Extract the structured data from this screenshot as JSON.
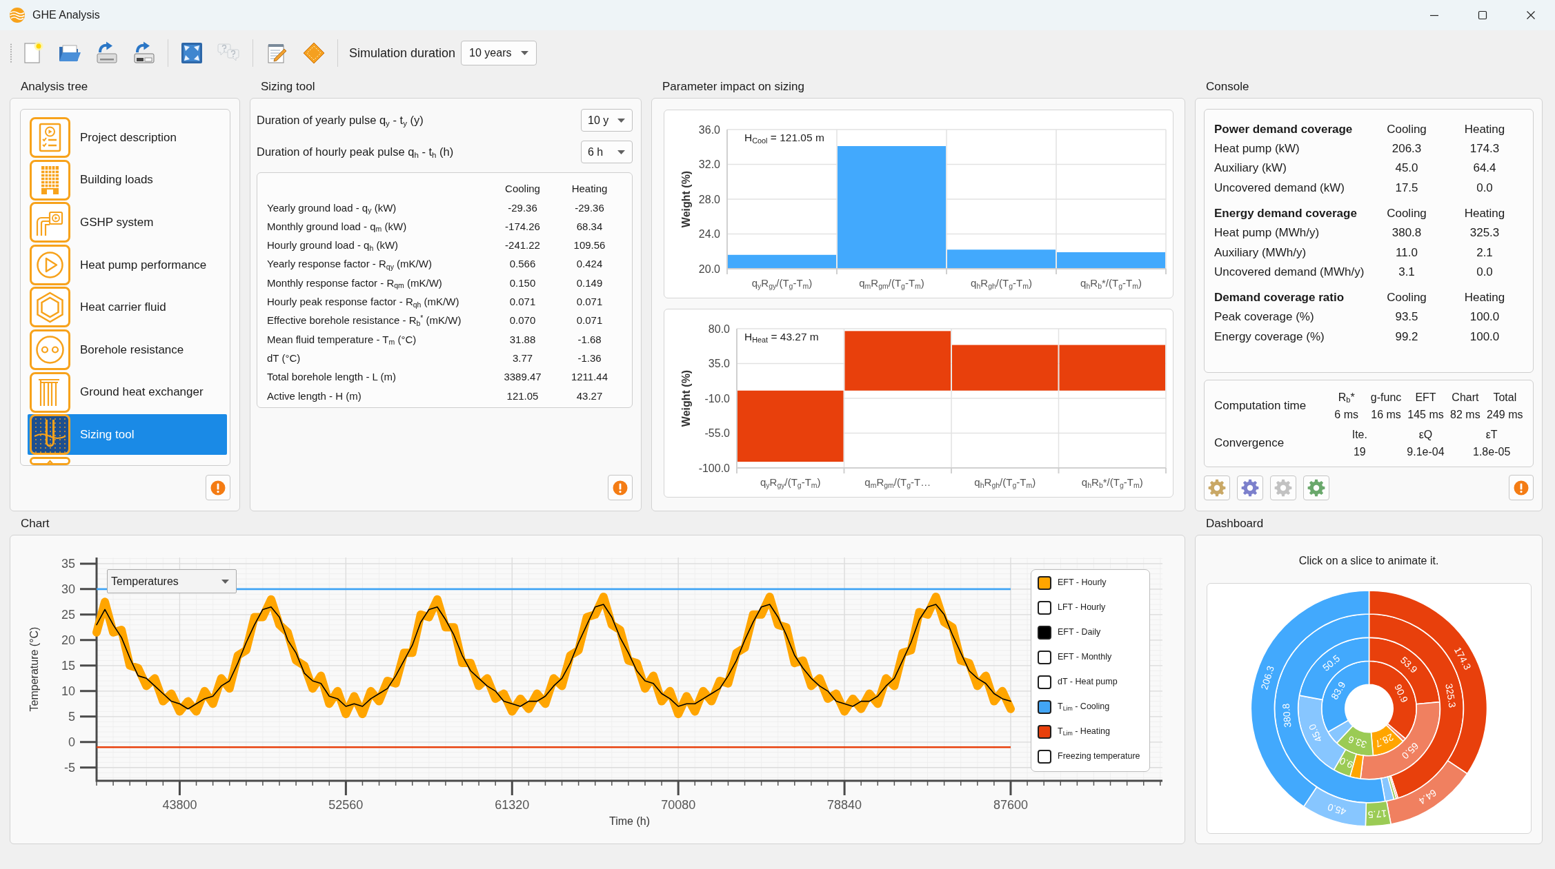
{
  "window": {
    "title": "GHE Analysis"
  },
  "toolbar": {
    "groups": [
      {
        "buttons": [
          {
            "kind": "new",
            "disabled": false
          },
          {
            "kind": "open",
            "disabled": false
          },
          {
            "kind": "save",
            "disabled": false
          },
          {
            "kind": "saveas",
            "disabled": false
          }
        ]
      },
      {
        "buttons": [
          {
            "kind": "fit",
            "disabled": false
          },
          {
            "kind": "help",
            "disabled": true
          }
        ]
      },
      {
        "buttons": [
          {
            "kind": "notes",
            "disabled": false
          },
          {
            "kind": "diamond",
            "disabled": false
          }
        ]
      }
    ],
    "simulation_duration": {
      "label": "Simulation duration",
      "value": "10 years"
    }
  },
  "analysis_tree": {
    "title": "Analysis tree",
    "items": [
      {
        "kind": "document",
        "label": "Project description",
        "selected": false
      },
      {
        "kind": "building",
        "label": "Building loads",
        "selected": false
      },
      {
        "kind": "gshp",
        "label": "GSHP system",
        "selected": false
      },
      {
        "kind": "play",
        "label": "Heat pump performance",
        "selected": false
      },
      {
        "kind": "hexagon",
        "label": "Heat carrier fluid",
        "selected": false
      },
      {
        "kind": "circle",
        "label": "Borehole resistance",
        "selected": false
      },
      {
        "kind": "pipes",
        "label": "Ground heat exchanger",
        "selected": false
      },
      {
        "kind": "sizing",
        "label": "Sizing tool",
        "selected": true
      },
      {
        "kind": "triangle",
        "selected": false
      }
    ]
  },
  "sizing_tool": {
    "title": "Sizing tool",
    "pulses": [
      {
        "label": "Duration of yearly pulse q$_{y}$ - t$_{y}$ (y)",
        "value": "10 y"
      },
      {
        "label": "Duration of hourly peak pulse q$_{h}$ - t$_{h}$ (h)",
        "value": "6 h"
      }
    ],
    "results": {
      "columns": [
        "Cooling",
        "Heating"
      ],
      "rows": [
        {
          "label": "Yearly ground load - q$_{y}$ (kW)",
          "values": [
            "-29.36",
            "-29.36"
          ]
        },
        {
          "label": "Monthly ground load - q$_{m}$ (kW)",
          "values": [
            "-174.26",
            "68.34"
          ]
        },
        {
          "label": "Hourly ground load - q$_{h}$ (kW)",
          "values": [
            "-241.22",
            "109.56"
          ]
        },
        {
          "label": "Yearly response factor - R$_{qy}$ (mK/W)",
          "values": [
            "0.566",
            "0.424"
          ]
        },
        {
          "label": "Monthly response factor - R$_{qm}$ (mK/W)",
          "values": [
            "0.150",
            "0.149"
          ]
        },
        {
          "label": "Hourly peak response factor - R$_{qh}$ (mK/W)",
          "values": [
            "0.071",
            "0.071"
          ]
        },
        {
          "label": "Effective borehole resistance - R$_{b}$$^{*}$ (mK/W)",
          "values": [
            "0.070",
            "0.071"
          ]
        },
        {
          "label": "Mean fluid temperature - T$_{m}$ (°C)",
          "values": [
            "31.88",
            "-1.68"
          ]
        },
        {
          "label": "dT (°C)",
          "values": [
            "3.77",
            "-1.36"
          ]
        },
        {
          "label": "Total borehole length - L (m)",
          "values": [
            "3389.47",
            "1211.44"
          ]
        },
        {
          "label": "Active length - H (m)",
          "values": [
            "121.05",
            "43.27"
          ]
        }
      ]
    }
  },
  "parameter_impact": {
    "title": "Parameter impact on sizing",
    "charts": [
      {
        "chart_data": {
          "type": "bar",
          "ylabel": "Weight (%)",
          "categories": [
            "q$_{y}$R$_{gy}$/(T$_{g}$-T$_{m}$)",
            "q$_{m}$R$_{gm}$/(T$_{g}$-T$_{m}$)",
            "q$_{h}$R$_{gh}$/(T$_{g}$-T$_{m}$)",
            "q$_{h}$R$_{b}$*/(T$_{g}$-T$_{m}$)"
          ],
          "series": [
            {
              "color": "#42a9fd",
              "values": [
                21.6,
                34.1,
                22.2,
                21.9
              ]
            }
          ],
          "ylim": [
            20,
            36
          ],
          "yticks": [
            {
              "value": 20,
              "label": "20.0"
            },
            {
              "value": 24,
              "label": "24.0"
            },
            {
              "value": 28,
              "label": "28.0"
            },
            {
              "value": 32,
              "label": "32.0"
            },
            {
              "value": 36,
              "label": "36.0"
            }
          ],
          "grid": true,
          "annotations": [
            {
              "text": "H$_{Cool}$ = 121.05 m"
            }
          ]
        }
      },
      {
        "chart_data": {
          "type": "bar",
          "ylabel": "Weight (%)",
          "categories": [
            "q$_{y}$R$_{gy}$/(T$_{g}$-T$_{m}$)",
            "q$_{m}$R$_{gm}$/(T$_{g}$-T…",
            "q$_{h}$R$_{gh}$/(T$_{g}$-T$_{m}$)",
            "q$_{h}$R$_{b}$*/(T$_{g}$-T$_{m}$)"
          ],
          "series": [
            {
              "color": "#e8400c",
              "values": [
                -92,
                77,
                59,
                59
              ]
            }
          ],
          "ylim": [
            -100,
            80
          ],
          "yticks": [
            {
              "value": -100,
              "label": "-100.0"
            },
            {
              "value": -55,
              "label": "-55.0"
            },
            {
              "value": -10,
              "label": "-10.0"
            },
            {
              "value": 35,
              "label": "35.0"
            },
            {
              "value": 80,
              "label": "80.0"
            }
          ],
          "grid": true,
          "annotations": [
            {
              "text": "H$_{Heat}$ = 43.27 m"
            }
          ]
        }
      }
    ]
  },
  "console": {
    "title": "Console",
    "sections": [
      {
        "title": "Power demand coverage",
        "columns": [
          "Cooling",
          "Heating"
        ],
        "rows": [
          {
            "label": "Heat pump (kW)",
            "values": [
              "206.3",
              "174.3"
            ]
          },
          {
            "label": "Auxiliary (kW)",
            "values": [
              "45.0",
              "64.4"
            ]
          },
          {
            "label": "Uncovered demand (kW)",
            "values": [
              "17.5",
              "0.0"
            ]
          }
        ]
      },
      {
        "title": "Energy demand coverage",
        "columns": [
          "Cooling",
          "Heating"
        ],
        "rows": [
          {
            "label": "Heat pump (MWh/y)",
            "values": [
              "380.8",
              "325.3"
            ]
          },
          {
            "label": "Auxiliary (MWh/y)",
            "values": [
              "11.0",
              "2.1"
            ]
          },
          {
            "label": "Uncovered demand (MWh/y)",
            "values": [
              "3.1",
              "0.0"
            ]
          }
        ]
      },
      {
        "title": "Demand coverage ratio",
        "columns": [
          "Cooling",
          "Heating"
        ],
        "rows": [
          {
            "label": "Peak coverage (%)",
            "values": [
              "93.5",
              "100.0"
            ]
          },
          {
            "label": "Energy coverage (%)",
            "values": [
              "99.2",
              "100.0"
            ]
          }
        ]
      }
    ],
    "computation_time": {
      "label": "Computation time",
      "items": [
        {
          "name": "R$_{b}$*",
          "value": "6 ms"
        },
        {
          "name": "g-func",
          "value": "16 ms"
        },
        {
          "name": "EFT",
          "value": "145 ms"
        },
        {
          "name": "Chart",
          "value": "82 ms"
        },
        {
          "name": "Total",
          "value": "249 ms"
        }
      ]
    },
    "convergence": {
      "label": "Convergence",
      "items": [
        {
          "name": "Ite.",
          "value": "19"
        },
        {
          "name": "εQ",
          "value": "9.1e-04"
        },
        {
          "name": "εT",
          "value": "1.8e-05"
        }
      ]
    },
    "tools": [
      {
        "color": "#c9a866"
      },
      {
        "color": "#7c80cc"
      },
      {
        "color": "#c2c2c2"
      },
      {
        "color": "#6aa86c"
      }
    ]
  },
  "chart": {
    "title": "Chart",
    "chart_selector": {
      "value": "Temperatures"
    },
    "legend": [
      {
        "label": "EFT - Hourly",
        "checked": true,
        "color": "#ffa500"
      },
      {
        "label": "LFT - Hourly",
        "checked": false
      },
      {
        "label": "EFT - Daily",
        "checked": true,
        "color": "#000000"
      },
      {
        "label": "EFT - Monthly",
        "checked": false
      },
      {
        "label": "dT - Heat pump",
        "checked": false
      },
      {
        "label": "T$_{Lim}$ - Cooling",
        "checked": true,
        "color": "#42a5f5"
      },
      {
        "label": "T$_{Lim}$ - Heating",
        "checked": true,
        "color": "#e8400c"
      },
      {
        "label": "Freezing temperature",
        "checked": false
      }
    ],
    "chart_data": {
      "type": "line",
      "xlabel": "Time (h)",
      "ylabel": "Temperature (°C)",
      "x": [
        39420,
        39858,
        40296,
        40734,
        41172,
        41610,
        42048,
        42486,
        42924,
        43362,
        43800,
        44238,
        44676,
        45114,
        45552,
        45990,
        46428,
        46866,
        47304,
        47742,
        48180,
        48618,
        49056,
        49494,
        49932,
        50370,
        50808,
        51246,
        51684,
        52122,
        52560,
        52998,
        53436,
        53874,
        54312,
        54750,
        55188,
        55626,
        56064,
        56502,
        56940,
        57378,
        57816,
        58254,
        58692,
        59130,
        59568,
        60006,
        60444,
        60882,
        61320,
        61758,
        62196,
        62634,
        63072,
        63510,
        63948,
        64386,
        64824,
        65262,
        65700,
        66138,
        66576,
        67014,
        67452,
        67890,
        68328,
        68766,
        69204,
        69642,
        70080,
        70518,
        70956,
        71394,
        71832,
        72270,
        72708,
        73146,
        73584,
        74022,
        74460,
        74898,
        75336,
        75774,
        76212,
        76650,
        77088,
        77526,
        77964,
        78402,
        78840,
        79278,
        79716,
        80154,
        80592,
        81030,
        81468,
        81906,
        82344,
        82782,
        83220,
        83658,
        84096,
        84534,
        84972,
        85410,
        85848,
        86286,
        86724,
        87162,
        87600
      ],
      "series": [
        {
          "color": "#ffa500",
          "values": [
            21.5,
            27.5,
            21.5,
            22.0,
            15.0,
            14.5,
            11.0,
            12.5,
            8.0,
            9.5,
            6.0,
            8.0,
            6.0,
            10.0,
            7.5,
            12.5,
            10.5,
            17.0,
            18.0,
            24.5,
            24.5,
            28.0,
            23.0,
            21.5,
            16.0,
            15.0,
            10.5,
            13.0,
            7.5,
            10.0,
            5.5,
            9.0,
            5.5,
            10.0,
            8.0,
            12.0,
            11.5,
            17.5,
            17.5,
            25.0,
            24.5,
            28.0,
            22.5,
            22.5,
            15.5,
            15.5,
            11.0,
            12.5,
            8.5,
            9.5,
            6.0,
            8.5,
            6.5,
            9.5,
            7.5,
            12.5,
            11.0,
            17.0,
            18.0,
            24.5,
            25.0,
            28.5,
            23.0,
            22.0,
            16.0,
            15.5,
            10.5,
            13.0,
            8.0,
            10.0,
            5.5,
            9.0,
            6.0,
            10.0,
            8.0,
            12.0,
            11.5,
            17.5,
            18.5,
            25.0,
            25.0,
            28.5,
            23.0,
            22.5,
            15.5,
            16.0,
            11.0,
            12.5,
            8.5,
            9.5,
            6.0,
            8.5,
            6.5,
            9.5,
            7.5,
            12.5,
            11.0,
            17.5,
            18.0,
            25.5,
            25.0,
            28.5,
            23.5,
            22.5,
            16.0,
            15.5,
            11.0,
            13.0,
            8.0,
            10.0,
            6.5
          ]
        },
        {
          "color": "#000000",
          "values": [
            23.0,
            26.0,
            23.0,
            20.5,
            16.5,
            13.0,
            12.5,
            11.0,
            9.5,
            8.0,
            7.5,
            6.5,
            7.5,
            8.5,
            9.0,
            11.0,
            12.0,
            15.5,
            19.5,
            23.0,
            26.0,
            26.5,
            24.5,
            20.0,
            17.5,
            13.5,
            12.0,
            11.5,
            9.0,
            8.5,
            7.0,
            7.5,
            7.0,
            8.5,
            9.5,
            10.5,
            13.0,
            16.0,
            19.0,
            23.5,
            26.0,
            26.5,
            24.0,
            21.0,
            17.0,
            14.0,
            12.5,
            11.0,
            10.0,
            8.0,
            7.5,
            7.0,
            8.0,
            8.0,
            9.0,
            11.0,
            12.5,
            15.5,
            19.5,
            23.0,
            26.5,
            27.0,
            24.5,
            20.5,
            17.5,
            14.0,
            12.0,
            11.5,
            9.5,
            8.5,
            7.0,
            7.5,
            7.5,
            8.5,
            9.5,
            10.5,
            13.0,
            16.0,
            20.0,
            23.5,
            26.5,
            27.0,
            24.5,
            21.0,
            17.0,
            14.5,
            12.5,
            11.0,
            10.0,
            8.0,
            7.5,
            7.0,
            8.0,
            8.0,
            9.0,
            11.0,
            12.5,
            16.0,
            19.5,
            24.0,
            26.5,
            27.0,
            25.0,
            21.0,
            17.5,
            14.0,
            12.5,
            11.5,
            9.5,
            8.5,
            8.0
          ]
        }
      ],
      "xlim": [
        39420,
        95600
      ],
      "ylim": [
        -7.6,
        36.2
      ],
      "xticks": [
        43800,
        52560,
        61320,
        70080,
        78840,
        87600
      ],
      "yticks": [
        -5,
        0,
        5,
        10,
        15,
        20,
        25,
        30,
        35
      ],
      "grid": true,
      "ref_lines": [
        {
          "axis": "y",
          "value": 30,
          "color": "#42a5f5"
        },
        {
          "axis": "y",
          "value": -1,
          "color": "#e8400c"
        }
      ]
    }
  },
  "dashboard": {
    "title": "Dashboard",
    "hint": "Click on a slice to animate it.",
    "chart_data": {
      "type": "donut",
      "series": [
        {
          "values": [
            90.9,
            3,
            28.7,
            33.6,
            12,
            83.9
          ],
          "colors": [
            "#e8400c",
            "#f08060",
            "#ffa500",
            "#9bcb55",
            "#87c6ff",
            "#42a9fd"
          ],
          "value_labels": [
            "90.9",
            null,
            "28.7",
            "33.6",
            null,
            "83.9"
          ]
        },
        {
          "values": [
            53.9,
            65.0,
            5.5,
            9.0,
            45.0,
            50.5
          ],
          "colors": [
            "#e8400c",
            "#f08060",
            "#ffa500",
            "#9bcb55",
            "#87c6ff",
            "#42a9fd"
          ],
          "value_labels": [
            "53.9",
            "65.0",
            null,
            "9.0",
            "45.0",
            "50.5"
          ]
        },
        {
          "values": [
            325.3,
            2.1,
            3.1,
            11.0,
            380.8
          ],
          "colors": [
            "#e8400c",
            "#f08060",
            "#9bcb55",
            "#87c6ff",
            "#42a9fd"
          ],
          "value_labels": [
            "325.3",
            null,
            null,
            null,
            "380.8"
          ]
        },
        {
          "values": [
            174.3,
            64.4,
            17.5,
            45.0,
            206.3
          ],
          "colors": [
            "#e8400c",
            "#f08060",
            "#9bcb55",
            "#87c6ff",
            "#42a9fd"
          ],
          "value_labels": [
            "174.3",
            "64.4",
            "17.5",
            "45.0",
            "206.3"
          ]
        }
      ]
    }
  }
}
